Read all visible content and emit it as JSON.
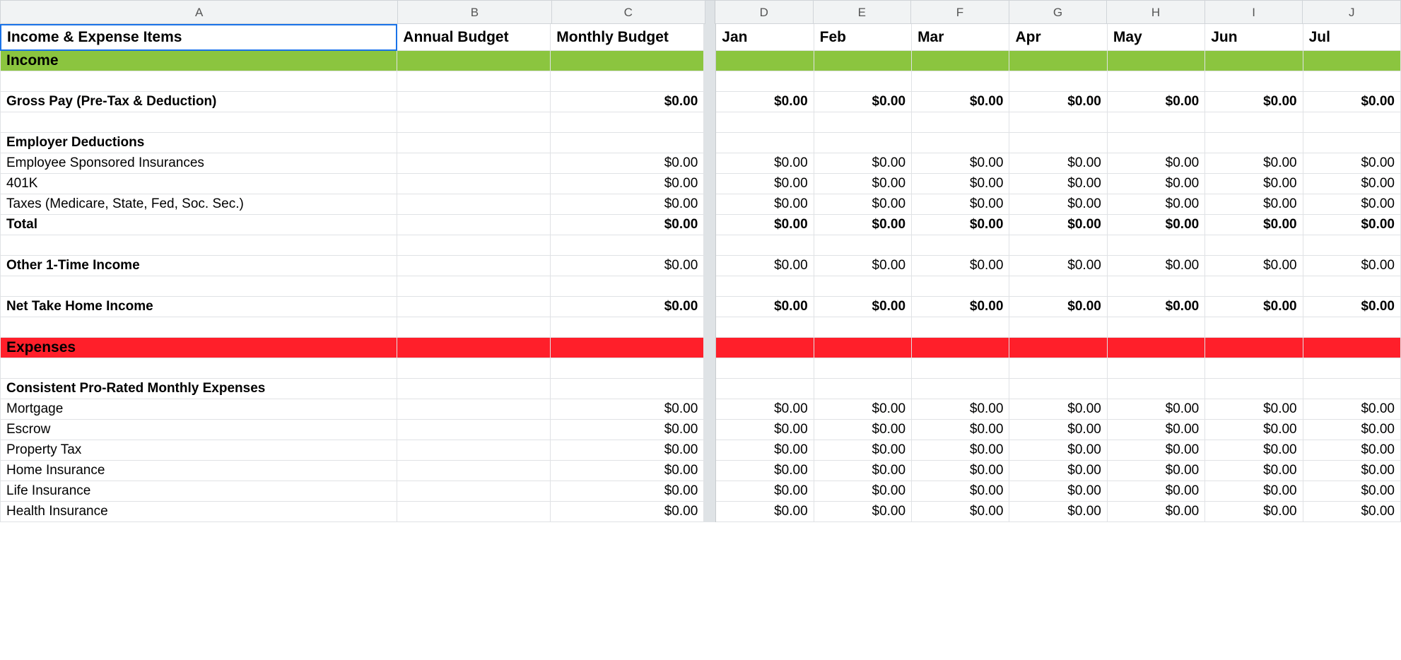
{
  "columns": [
    "A",
    "B",
    "C",
    "D",
    "E",
    "F",
    "G",
    "H",
    "I",
    "J"
  ],
  "headers": {
    "A": "Income & Expense Items",
    "B": "Annual Budget",
    "C": "Monthly Budget",
    "D": "Jan",
    "E": "Feb",
    "F": "Mar",
    "G": "Apr",
    "H": "May",
    "I": "Jun",
    "J": "Jul"
  },
  "rows": [
    {
      "type": "header",
      "tall": true
    },
    {
      "type": "section",
      "style": "income",
      "label": "Income"
    },
    {
      "type": "blank"
    },
    {
      "type": "data",
      "label": "Gross Pay (Pre-Tax & Deduction)",
      "bold": true,
      "startCol": "C",
      "value": "$0.00"
    },
    {
      "type": "blank"
    },
    {
      "type": "label",
      "label": "Employer Deductions",
      "bold": true
    },
    {
      "type": "data",
      "label": "Employee Sponsored Insurances",
      "bold": false,
      "startCol": "C",
      "value": "$0.00"
    },
    {
      "type": "data",
      "label": "401K",
      "bold": false,
      "startCol": "C",
      "value": "$0.00"
    },
    {
      "type": "data",
      "label": "Taxes (Medicare, State, Fed, Soc. Sec.)",
      "bold": false,
      "startCol": "C",
      "value": "$0.00"
    },
    {
      "type": "data",
      "label": "Total",
      "bold": true,
      "startCol": "C",
      "value": "$0.00"
    },
    {
      "type": "blank"
    },
    {
      "type": "data",
      "label": "Other 1-Time Income",
      "bold": true,
      "boldValues": false,
      "startCol": "C",
      "value": "$0.00"
    },
    {
      "type": "blank"
    },
    {
      "type": "data",
      "label": "Net Take Home Income",
      "bold": true,
      "startCol": "C",
      "value": "$0.00"
    },
    {
      "type": "blank"
    },
    {
      "type": "section",
      "style": "expense",
      "label": "Expenses"
    },
    {
      "type": "blank"
    },
    {
      "type": "label",
      "label": "Consistent Pro-Rated Monthly Expenses",
      "bold": true
    },
    {
      "type": "data",
      "label": "Mortgage",
      "bold": false,
      "startCol": "C",
      "value": "$0.00"
    },
    {
      "type": "data",
      "label": "Escrow",
      "bold": false,
      "startCol": "C",
      "value": "$0.00"
    },
    {
      "type": "data",
      "label": "Property Tax",
      "bold": false,
      "startCol": "C",
      "value": "$0.00"
    },
    {
      "type": "data",
      "label": "Home Insurance",
      "bold": false,
      "startCol": "C",
      "value": "$0.00"
    },
    {
      "type": "data",
      "label": "Life Insurance",
      "bold": false,
      "startCol": "C",
      "value": "$0.00"
    },
    {
      "type": "data",
      "label": "Health Insurance",
      "bold": false,
      "startCol": "C",
      "value": "$0.00"
    }
  ]
}
